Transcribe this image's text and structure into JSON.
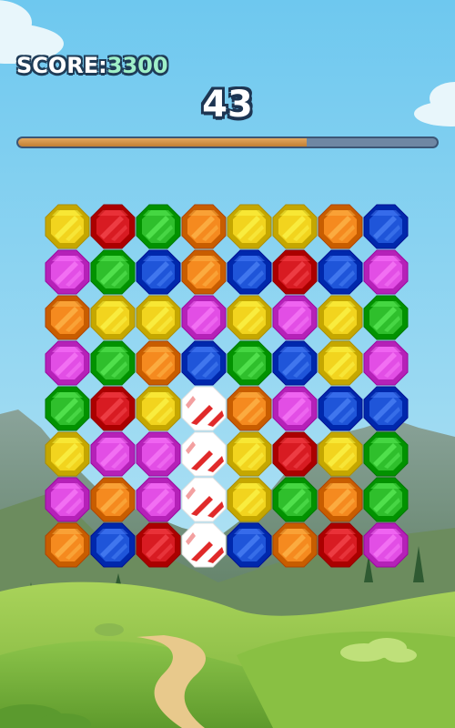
{
  "hud": {
    "score_label": "SCORE:",
    "score_value": "3300",
    "timer": "43",
    "time_remaining_fraction": 0.69
  },
  "colors": {
    "yellow": "#f2d41e",
    "red": "#d81b22",
    "green": "#2fbf2c",
    "orange": "#f58a1f",
    "blue": "#1f55d9",
    "magenta": "#e24ee5",
    "white": "#ffffff"
  },
  "board": {
    "rows": [
      [
        "yellow",
        "red",
        "green",
        "orange",
        "yellow",
        "yellow",
        "orange",
        "blue"
      ],
      [
        "magenta",
        "green",
        "blue",
        "orange",
        "blue",
        "red",
        "blue",
        "magenta"
      ],
      [
        "orange",
        "yellow",
        "yellow",
        "magenta",
        "yellow",
        "magenta",
        "yellow",
        "green"
      ],
      [
        "magenta",
        "green",
        "orange",
        "blue",
        "green",
        "blue",
        "yellow",
        "magenta"
      ],
      [
        "green",
        "red",
        "yellow",
        "white",
        "orange",
        "magenta",
        "blue",
        "blue"
      ],
      [
        "yellow",
        "magenta",
        "magenta",
        "white",
        "yellow",
        "red",
        "yellow",
        "green"
      ],
      [
        "magenta",
        "orange",
        "magenta",
        "white",
        "yellow",
        "green",
        "orange",
        "green"
      ],
      [
        "orange",
        "blue",
        "red",
        "white",
        "blue",
        "orange",
        "red",
        "magenta"
      ]
    ]
  }
}
